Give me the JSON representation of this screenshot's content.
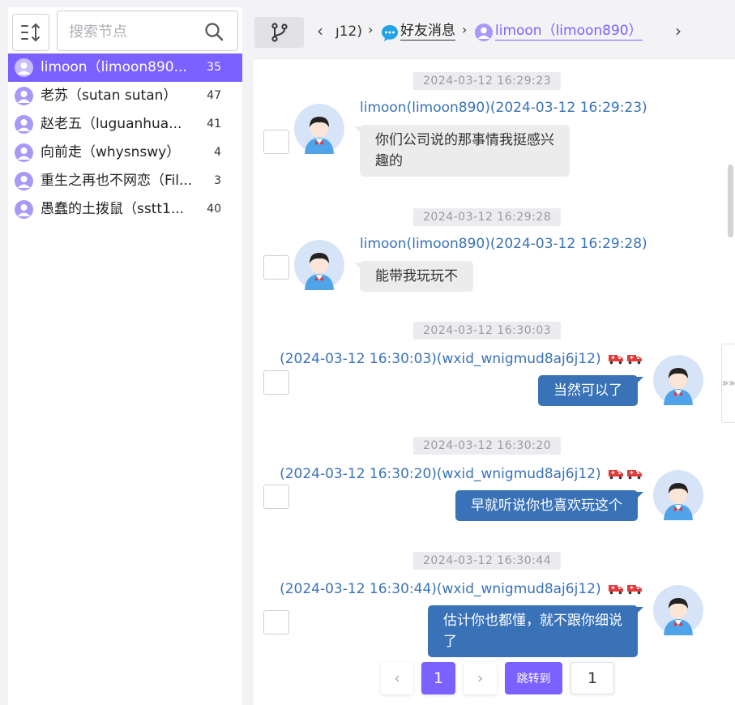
{
  "search": {
    "placeholder": "搜索节点"
  },
  "contacts": [
    {
      "name": "limoon（limoon890...",
      "count": "35",
      "selected": true
    },
    {
      "name": "老苏（sutan sutan）",
      "count": "47"
    },
    {
      "name": "赵老五（luguanhua...",
      "count": "41"
    },
    {
      "name": "向前走（whysnswy）",
      "count": "4"
    },
    {
      "name": "重生之再也不网恋（Fil...",
      "count": "3"
    },
    {
      "name": "愚蠢的土拨鼠（sstt1...",
      "count": "40"
    }
  ],
  "breadcrumb": {
    "back": "‹",
    "segment_partial": "ȷ12)",
    "sep1": "›",
    "section": "好友消息",
    "sep2": "›",
    "current": "limoon（limoon890）",
    "forward": "›"
  },
  "messages": [
    {
      "time": "2024-03-12 16:29:23",
      "sender": "limoon(limoon890)(2024-03-12 16:29:23)",
      "text_lines": [
        "你们公司说的那事情我挺感兴",
        "趣的"
      ],
      "direction": "in"
    },
    {
      "time": "2024-03-12 16:29:28",
      "sender": "limoon(limoon890)(2024-03-12 16:29:28)",
      "text_lines": [
        "能带我玩玩不"
      ],
      "direction": "in"
    },
    {
      "time": "2024-03-12 16:30:03",
      "sender": "(2024-03-12 16:30:03)(wxid_wnigmud8aj6j12)",
      "text_lines": [
        "当然可以了"
      ],
      "direction": "out"
    },
    {
      "time": "2024-03-12 16:30:20",
      "sender": "(2024-03-12 16:30:20)(wxid_wnigmud8aj6j12)",
      "text_lines": [
        "早就听说你也喜欢玩这个"
      ],
      "direction": "out"
    },
    {
      "time": "2024-03-12 16:30:44",
      "sender": "(2024-03-12 16:30:44)(wxid_wnigmud8aj6j12)",
      "text_lines": [
        "估计你也都懂，就不跟你细说",
        "了"
      ],
      "direction": "out"
    }
  ],
  "side_handle": "»»",
  "pagination": {
    "prev": "‹",
    "current_page": "1",
    "next": "›",
    "jump_label": "跳转到",
    "jump_value": "1"
  },
  "colors": {
    "accent": "#7b61ff",
    "outgoing_bubble": "#3a72b8",
    "sender_text": "#3a72b8"
  },
  "icons": [
    "sort-icon",
    "search-icon",
    "user-avatar-icon",
    "branch-icon",
    "chat-bubble-icon",
    "delivery-truck-icon"
  ]
}
